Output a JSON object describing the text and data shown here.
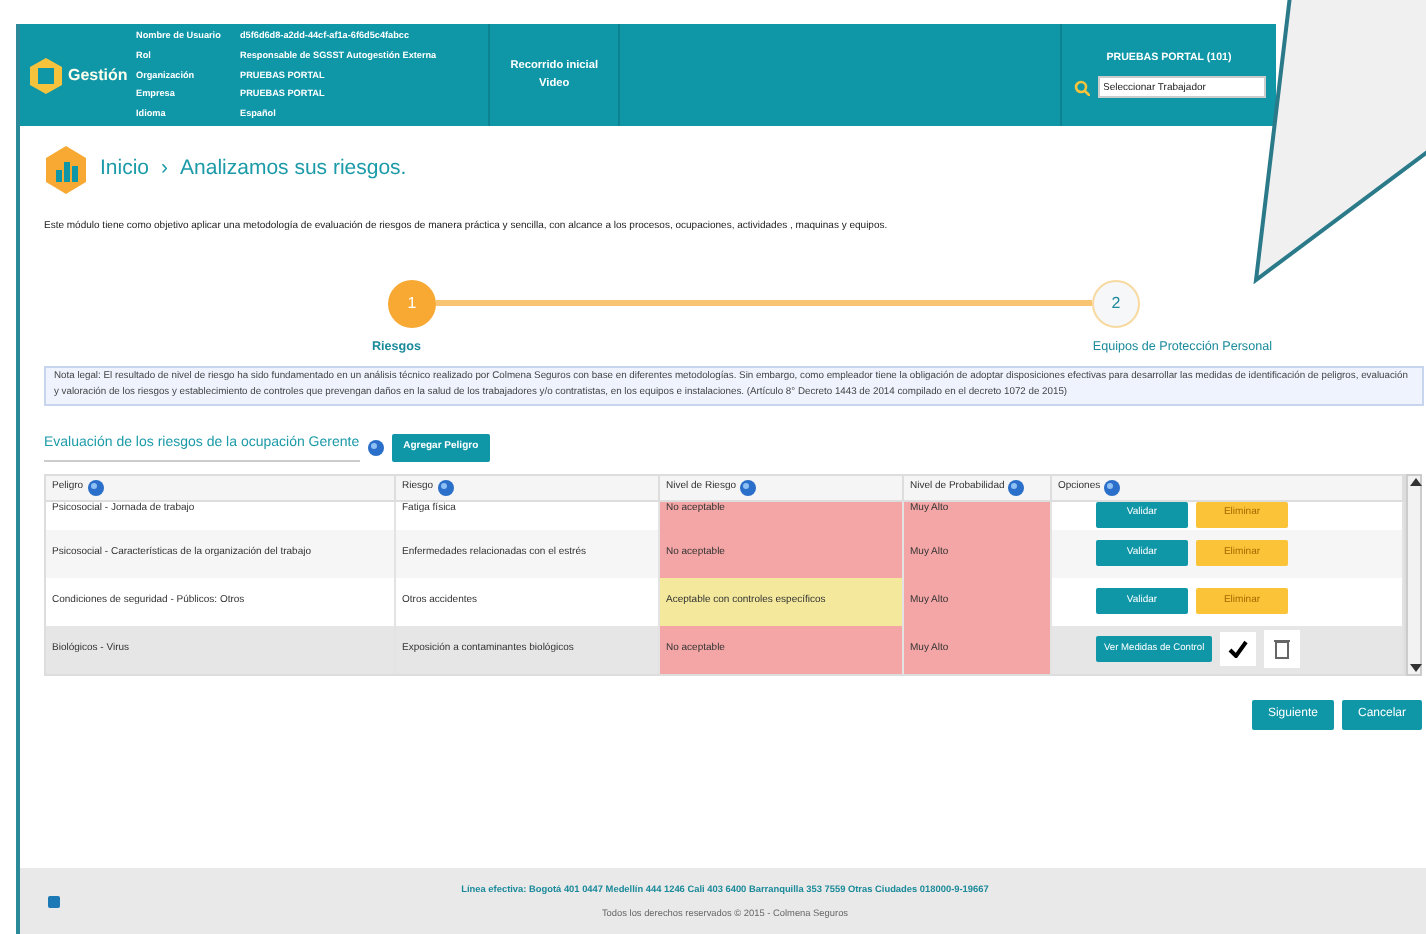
{
  "header": {
    "logo_text": "Gestión",
    "user_info": [
      {
        "label": "Nombre de Usuario",
        "value": "d5f6d6d8-a2dd-44cf-af1a-6f6d5c4fabcc"
      },
      {
        "label": "Rol",
        "value": "Responsable de SGSST Autogestión Externa"
      },
      {
        "label": "Organización",
        "value": "PRUEBAS PORTAL"
      },
      {
        "label": "Empresa",
        "value": "PRUEBAS PORTAL"
      },
      {
        "label": "Idioma",
        "value": "Español"
      }
    ],
    "links": [
      "Recorrido inicial",
      "Video"
    ],
    "company": "PRUEBAS PORTAL (101)",
    "worker_search": {
      "value": "Seleccionar Trabajador"
    }
  },
  "breadcrumb": [
    "Inicio",
    "›",
    "Analizamos sus riesgos."
  ],
  "description": "Este módulo tiene como objetivo aplicar una metodología de evaluación de riesgos de manera práctica y sencilla, con alcance a los procesos, ocupaciones, actividades , maquinas y equipos.",
  "steps": [
    {
      "number": "1",
      "label": "Riesgos",
      "selected": true
    },
    {
      "number": "2",
      "label": "Equipos de Protección Personal",
      "selected": false
    }
  ],
  "legal_note": "Nota legal: El resultado de nivel de riesgo ha sido fundamentado en un análisis técnico realizado  por Colmena Seguros con base en diferentes metodologías. Sin embargo, como empleador tiene la obligación de adoptar disposiciones efectivas para desarrollar las medidas de identificación de peligros, evaluación y valoración de los riesgos y establecimiento de controles que prevengan daños en la salud de los trabajadores y/o contratistas, en los equipos e instalaciones. (Artículo 8° Decreto 1443 de 2014 compilado en el decreto 1072 de 2015)",
  "section_title": "Evaluación de los riesgos de la ocupación Gerente",
  "add_button": "Agregar Peligro",
  "table": {
    "columns": [
      "Peligro",
      "Riesgo",
      "Nivel de Riesgo",
      "Nivel de Probabilidad",
      "Opciones"
    ],
    "rows": [
      {
        "hazard": "Psicosocial - Jornada de trabajo",
        "risk": "Fatiga física",
        "risk_level": {
          "text": "No aceptable",
          "color": "#f4a6a6"
        },
        "probability": {
          "text": "Muy Alto",
          "color": "#f4a6a6"
        },
        "selected": false,
        "kind": "validate",
        "actions": [
          "Validar",
          "Eliminar"
        ]
      },
      {
        "hazard": "Psicosocial - Características de la organización del trabajo",
        "risk": "Enfermedades relacionadas con el estrés",
        "risk_level": {
          "text": "No aceptable",
          "color": "#f4a6a6"
        },
        "probability": {
          "text": "Muy Alto",
          "color": "#f4a6a6"
        },
        "selected": false,
        "kind": "validate",
        "actions": [
          "Validar",
          "Eliminar"
        ]
      },
      {
        "hazard": "Condiciones de seguridad - Públicos: Otros",
        "risk": "Otros accidentes",
        "risk_level": {
          "text": "Aceptable con controles específicos",
          "color": "#f3e89c"
        },
        "probability": {
          "text": "Muy Alto",
          "color": "#f4a6a6"
        },
        "selected": false,
        "kind": "validate",
        "actions": [
          "Validar",
          "Eliminar"
        ]
      },
      {
        "hazard": "Biológicos - Virus",
        "risk": "Exposición a contaminantes biológicos",
        "risk_level": {
          "text": "No aceptable",
          "color": "#f4a6a6"
        },
        "probability": {
          "text": "Muy Alto",
          "color": "#f4a6a6"
        },
        "selected": true,
        "kind": "measures",
        "actions": [
          "Ver Medidas de Control"
        ]
      }
    ]
  },
  "buttons": [
    "Siguiente",
    "Cancelar"
  ],
  "footer": {
    "phones": "Línea efectiva: Bogotá 401 0447 Medellín 444 1246 Cali 403 6400 Barranquilla 353 7559 Otras Ciudades 018000-9-19667",
    "copyright": "Todos los derechos reservados © 2015 - Colmena Seguros"
  }
}
